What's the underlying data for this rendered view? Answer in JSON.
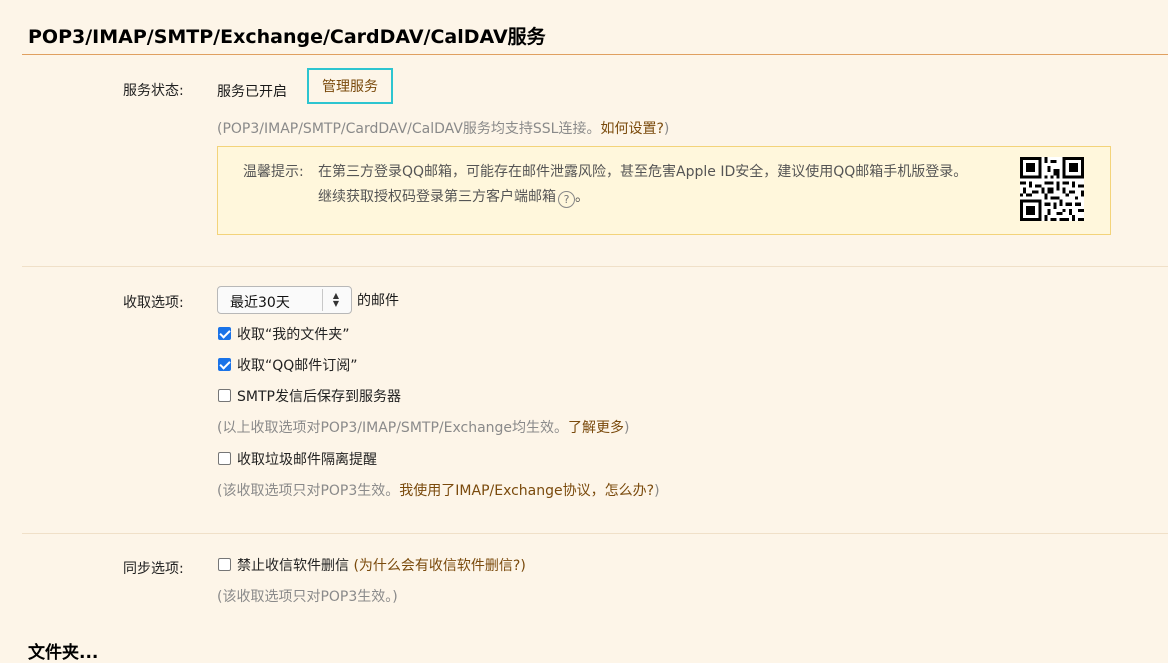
{
  "page": {
    "title": "POP3/IMAP/SMTP/Exchange/CardDAV/CalDAV服务",
    "next_section_title": "文件夹..."
  },
  "service": {
    "label": "服务状态:",
    "status": "服务已开启",
    "manage_label": "管理服务",
    "ssl_hint_prefix": "(POP3/IMAP/SMTP/CardDAV/CalDAV服务均支持SSL连接。",
    "ssl_hint_link": "如何设置?",
    "ssl_hint_suffix": ")"
  },
  "notice": {
    "label": "温馨提示:",
    "line1": "在第三方登录QQ邮箱，可能存在邮件泄露风险，甚至危害Apple ID安全，建议使用QQ邮箱手机版登录。",
    "line2": "继续获取授权码登录第三方客户端邮箱",
    "line2_suffix": "。",
    "help_glyph": "?"
  },
  "receive": {
    "label": "收取选项:",
    "select_value": "最近30天",
    "select_suffix": "的邮件",
    "options": [
      {
        "label": "收取“我的文件夹”",
        "checked": true
      },
      {
        "label": "收取“QQ邮件订阅”",
        "checked": true
      },
      {
        "label": "SMTP发信后保存到服务器",
        "checked": false
      }
    ],
    "hint1_prefix": "(以上收取选项对POP3/IMAP/SMTP/Exchange均生效。",
    "hint1_link": "了解更多",
    "hint1_suffix": ")",
    "spam_option": {
      "label": "收取垃圾邮件隔离提醒",
      "checked": false
    },
    "hint2_prefix": "(该收取选项只对POP3生效。",
    "hint2_link": "我使用了IMAP/Exchange协议，怎么办?",
    "hint2_suffix": ")"
  },
  "sync": {
    "label": "同步选项:",
    "option": {
      "label": "禁止收信软件删信",
      "checked": false
    },
    "option_link": "(为什么会有收信软件删信?)",
    "hint": "(该收取选项只对POP3生效。)"
  },
  "icons": {
    "qr": "qr-code-icon",
    "help": "question-circle-icon",
    "select_arrow": "updown-chevron-icon"
  },
  "colors": {
    "background": "#fdf5e8",
    "link": "#7a4a0c",
    "focus_border": "#2dc5d0",
    "notice_border": "#f3d37a",
    "checkbox_checked": "#1a73e8"
  }
}
